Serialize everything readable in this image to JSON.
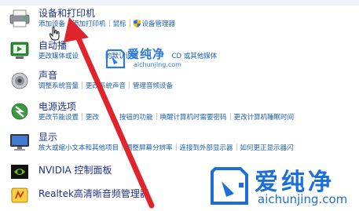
{
  "devices": {
    "title": "设备和打印机",
    "links": [
      "添加设备",
      "添加打印机",
      "鼠标",
      "设备管理器"
    ]
  },
  "autoplay": {
    "title": "自动播",
    "links": [
      "更改媒体或设",
      "的默认设置",
      "CD 或其他媒体"
    ],
    "links_visible_text": "更改媒体或设备的默认设置 | 自动播放CD 或其他媒体"
  },
  "sound": {
    "title": "声音",
    "links": [
      "调整系统音量",
      "更改系统声音",
      "管理音频设备"
    ]
  },
  "power": {
    "title": "电源选项",
    "links": [
      "更改节能设置",
      "更改",
      "按钮的功能",
      "唤醒计算机时需要密码",
      "更改计算机睡眠时间"
    ]
  },
  "display": {
    "title": "显示",
    "links": [
      "放大或缩小文本和其他项目",
      "调整屏幕分辨率",
      "连接到外部显示器",
      "如何更正显示器闪"
    ]
  },
  "nvidia": {
    "title": "NVIDIA 控制面板"
  },
  "realtek": {
    "title": "Realtek高清晰音频管理器"
  },
  "watermark_large": {
    "brand": "爱纯净",
    "url": "aichunjing.com"
  },
  "watermark_small": {
    "brand": "爱纯净",
    "url": "aichunjing.com"
  },
  "colors": {
    "link": "#1a5fb4",
    "title": "#1e3287",
    "arrow": "#e0242c",
    "watermark": "#1c6fd8"
  }
}
